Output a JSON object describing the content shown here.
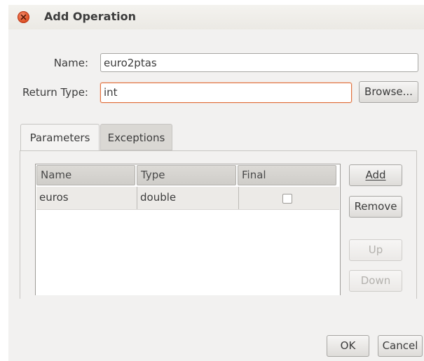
{
  "dialog": {
    "title": "Add Operation"
  },
  "form": {
    "name_label": "Name:",
    "name_value": "euro2ptas",
    "return_type_label": "Return Type:",
    "return_type_value": "int",
    "browse_label": "Browse..."
  },
  "tabs": [
    {
      "label": "Parameters",
      "active": true
    },
    {
      "label": "Exceptions",
      "active": false
    }
  ],
  "table": {
    "columns": [
      "Name",
      "Type",
      "Final"
    ],
    "rows": [
      {
        "name": "euros",
        "type": "double",
        "final": false
      }
    ]
  },
  "side_buttons": {
    "add": "Add",
    "remove": "Remove",
    "up": "Up",
    "down": "Down"
  },
  "footer": {
    "ok": "OK",
    "cancel": "Cancel"
  },
  "colors": {
    "focus_border": "#e0723f",
    "close_button": "#e05428",
    "window_bg": "#f2f1f0"
  }
}
